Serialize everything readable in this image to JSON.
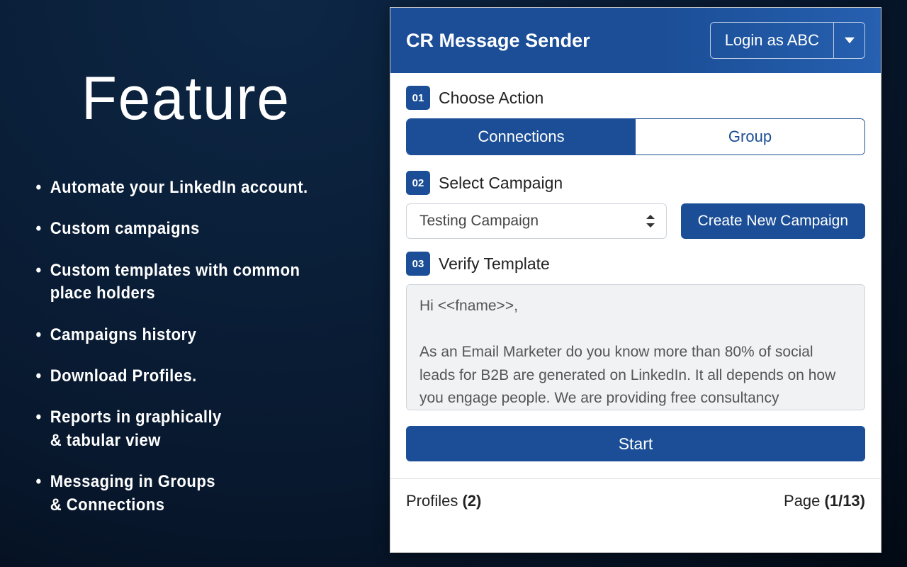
{
  "left": {
    "heading": "Feature",
    "bullets": [
      "Automate your LinkedIn account.",
      "Custom campaigns",
      "Custom templates with common\n  place holders",
      "Campaigns history",
      "Download Profiles.",
      "Reports in graphically\n  & tabular view",
      "Messaging in Groups\n  & Connections"
    ]
  },
  "panel": {
    "title": "CR Message Sender",
    "login_label": "Login as ABC",
    "steps": {
      "s1": {
        "num": "01",
        "label": "Choose Action"
      },
      "s2": {
        "num": "02",
        "label": "Select Campaign"
      },
      "s3": {
        "num": "03",
        "label": "Verify Template"
      }
    },
    "tabs": {
      "connections": "Connections",
      "group": "Group"
    },
    "campaign_selected": "Testing Campaign",
    "create_campaign_label": "Create New Campaign",
    "template_text": "Hi <<fname>>,\n\nAs an Email Marketer do you know more than 80% of social leads for B2B are generated on LinkedIn. It all depends on how you engage people. We are providing free consultancy",
    "start_label": "Start",
    "footer": {
      "profiles_label": "Profiles ",
      "profiles_value": "(2)",
      "page_label": "Page ",
      "page_value": "(1/13)"
    }
  }
}
